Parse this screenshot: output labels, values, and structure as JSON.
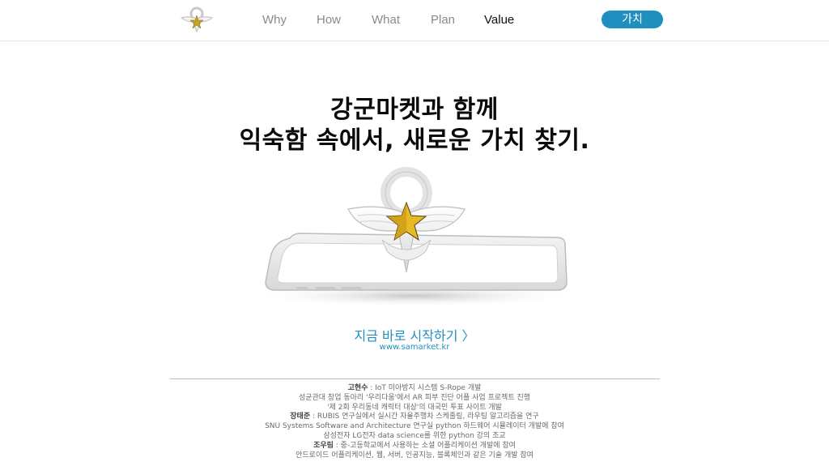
{
  "header": {
    "nav": [
      "Why",
      "How",
      "What",
      "Plan",
      "Value"
    ],
    "active": "Value",
    "cta_label": "가치"
  },
  "hero": {
    "title_line1": "강군마켓과 함께",
    "title_line2": "익숙함 속에서, 새로운 가치 찾기."
  },
  "start": {
    "label": "지금 바로 시작하기 〉",
    "url": "www.samarket.kr"
  },
  "credits": [
    {
      "name": "고현수",
      "text": " : IoT 미아방지 시스템 S-Rope 개발"
    },
    {
      "name": "",
      "text": "성균관대 창업 동아리 '우리다움'에서 AR 피부 진단 어플 사업 프로젝트 진행"
    },
    {
      "name": "",
      "text": "'제 2회 우리동네 캐릭터 대상'의 대국민 투표 사이트 개발"
    },
    {
      "name": "장태준",
      "text": " : RUBIS 연구실에서 실시간 자율주행차 스케줄링, 라우팅 알고리즘을 연구"
    },
    {
      "name": "",
      "text": "SNU Systems Software and Architecture 연구실 python 하드웨어 시뮬레이터 개발에 참여"
    },
    {
      "name": "",
      "text": "삼성전자 LG전자 data science를 위한 python 강의 조교"
    },
    {
      "name": "조우림",
      "text": " : 중-고등학교에서 사용하는 소셜 어플리케이션 개발에 참여"
    },
    {
      "name": "",
      "text": "안드로이드 어플리케이션, 웹, 서버, 인공지능, 블록체인과 같은 기술 개발 참여"
    }
  ],
  "colors": {
    "accent": "#1f8fbf",
    "star": "#e8b923"
  },
  "icons": {
    "logo": "army-emblem-icon"
  }
}
